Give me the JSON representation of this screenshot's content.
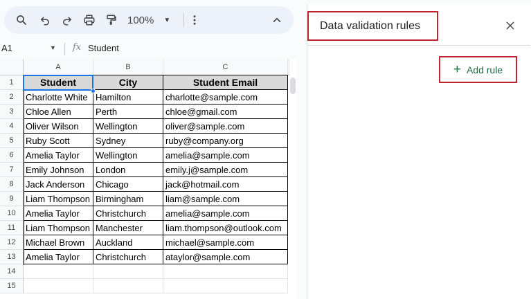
{
  "toolbar": {
    "zoom": "100%",
    "icons": [
      "search-icon",
      "undo-icon",
      "redo-icon",
      "print-icon",
      "paint-format-icon",
      "zoom-caret-icon",
      "more-vert-icon",
      "collapse-chevron-icon"
    ]
  },
  "formula_bar": {
    "name_box": "A1",
    "fx_label": "fx",
    "value": "Student"
  },
  "grid": {
    "columns": [
      "A",
      "B",
      "C"
    ],
    "rows": [
      "1",
      "2",
      "3",
      "4",
      "5",
      "6",
      "7",
      "8",
      "9",
      "10",
      "11",
      "12",
      "13",
      "14",
      "15"
    ],
    "header": [
      "Student",
      "City",
      "Student Email"
    ],
    "data": [
      [
        "Charlotte White",
        "Hamilton",
        "charlotte@sample.com"
      ],
      [
        "Chloe Allen",
        "Perth",
        "chloe@gmail.com"
      ],
      [
        "Oliver Wilson",
        "Wellington",
        "oliver@sample.com"
      ],
      [
        "Ruby Scott",
        "Sydney",
        "ruby@company.org"
      ],
      [
        "Amelia Taylor",
        "Wellington",
        "amelia@sample.com"
      ],
      [
        "Emily Johnson",
        "London",
        "emily.j@sample.com"
      ],
      [
        "Jack Anderson",
        "Chicago",
        "jack@hotmail.com"
      ],
      [
        "Liam Thompson",
        "Birmingham",
        "liam@sample.com"
      ],
      [
        "Amelia Taylor",
        "Christchurch",
        "amelia@sample.com"
      ],
      [
        "Liam Thompson",
        "Manchester",
        "liam.thompson@outlook.com"
      ],
      [
        "Michael Brown",
        "Auckland",
        "michael@sample.com"
      ],
      [
        "Amelia Taylor",
        "Christchurch",
        "ataylor@sample.com"
      ]
    ]
  },
  "panel": {
    "title": "Data validation rules",
    "add_rule_label": "Add rule",
    "highlight_color": "#c0262d",
    "accent_color": "#1e6b3f"
  }
}
